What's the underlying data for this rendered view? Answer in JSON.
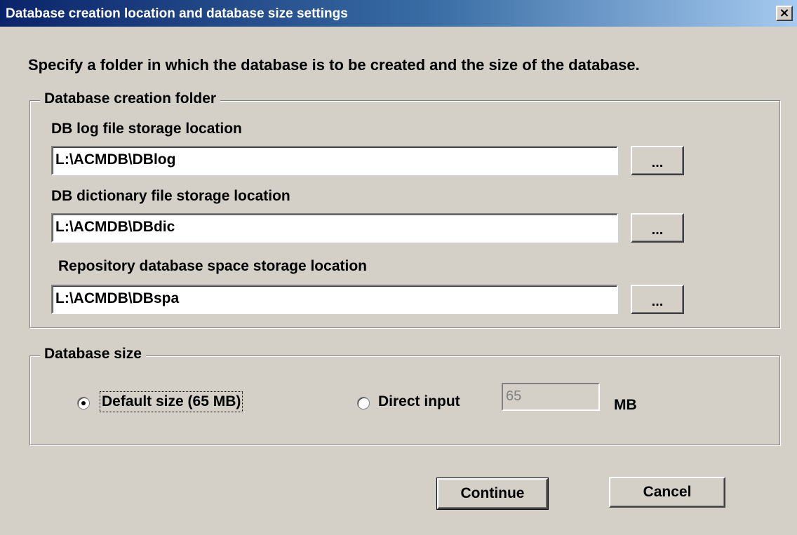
{
  "window": {
    "title": "Database creation location and database size settings",
    "close_glyph": "×"
  },
  "instruction": "Specify a folder in which the database is to be created and the size of the database.",
  "folder_group": {
    "legend": "Database creation folder",
    "fields": [
      {
        "label": "DB log file storage location",
        "value": "L:\\ACMDB\\DBlog",
        "browse_label": "..."
      },
      {
        "label": "DB dictionary file storage location",
        "value": "L:\\ACMDB\\DBdic",
        "browse_label": "..."
      },
      {
        "label": "Repository database space storage location",
        "value": "L:\\ACMDB\\DBspa",
        "browse_label": "..."
      }
    ]
  },
  "size_group": {
    "legend": "Database size",
    "default_option": {
      "label": "Default size (65 MB)",
      "selected": true
    },
    "direct_option": {
      "label": "Direct input",
      "selected": false
    },
    "direct_value": "65",
    "unit": "MB"
  },
  "buttons": {
    "continue": "Continue",
    "cancel": "Cancel"
  }
}
